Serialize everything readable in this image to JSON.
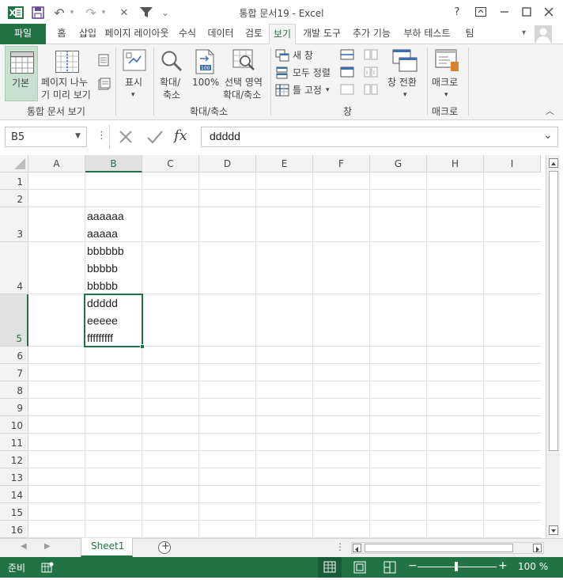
{
  "window": {
    "title": "통합 문서19 - Excel",
    "help": "?",
    "restore_ribbon": "⊡",
    "minimize": "—",
    "maximize": "☐",
    "close": "✕"
  },
  "quick_access": {
    "undo_icon": "↶",
    "redo_icon": "↷",
    "cancel_icon": "✕",
    "filter_icon": "▼",
    "customize_icon": "⌄"
  },
  "tabs": [
    {
      "label": "파일"
    },
    {
      "label": "홈"
    },
    {
      "label": "삽입"
    },
    {
      "label": "페이지 레이아웃"
    },
    {
      "label": "수식"
    },
    {
      "label": "데이터"
    },
    {
      "label": "검토"
    },
    {
      "label": "보기"
    },
    {
      "label": "개발 도구"
    },
    {
      "label": "추가 기능"
    },
    {
      "label": "부하 테스트"
    },
    {
      "label": "팀"
    }
  ],
  "ribbon": {
    "workbook_views": {
      "normal": "기본",
      "page_break_1": "페이지 나누",
      "page_break_2": "기 미리 보기",
      "group_label": "통합 문서 보기"
    },
    "show": {
      "label": "표시"
    },
    "zoom": {
      "zoom_1": "확대/",
      "zoom_2": "축소",
      "hundred": "100%",
      "selection_1": "선택 영역",
      "selection_2": "확대/축소",
      "group_label": "확대/축소"
    },
    "window": {
      "new_window": "새 창",
      "arrange_all": "모두 정렬",
      "freeze_panes": "틀 고정",
      "switch_windows": "창 전환",
      "group_label": "창"
    },
    "macros": {
      "label": "매크로",
      "group_label": "매크로"
    }
  },
  "formula_bar": {
    "name_box": "B5",
    "fx": "fx",
    "value": "ddddd"
  },
  "columns": [
    "A",
    "B",
    "C",
    "D",
    "E",
    "F",
    "G",
    "H",
    "I"
  ],
  "rows": [
    "1",
    "2",
    "3",
    "4",
    "5",
    "6",
    "7",
    "8",
    "9",
    "10",
    "11",
    "12",
    "13",
    "14",
    "15",
    "16"
  ],
  "cells": {
    "B3": [
      "aaaaaa",
      "aaaaa"
    ],
    "B4": [
      "bbbbbb",
      "bbbbb",
      "bbbbb"
    ],
    "B5": [
      "ddddd",
      "eeeee",
      "fffffffff"
    ]
  },
  "sheet_tabs": {
    "sheet1": "Sheet1",
    "add": "+"
  },
  "status": {
    "ready": "준비",
    "zoom": "100 %"
  }
}
